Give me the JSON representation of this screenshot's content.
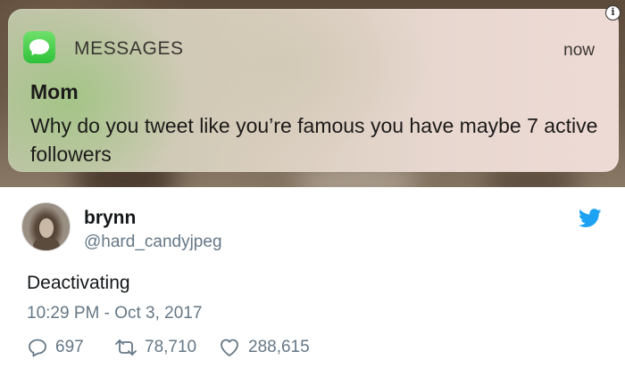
{
  "notification": {
    "app_name": "MESSAGES",
    "time": "now",
    "sender": "Mom",
    "message": "Why do you tweet like you’re famous you have maybe 7 active followers",
    "app_icon": "messages-app-icon",
    "info_icon": "i"
  },
  "tweet": {
    "display_name": "brynn",
    "handle": "@hard_candyjpeg",
    "text": "Deactivating",
    "timestamp": "10:29 PM - Oct 3, 2017",
    "brand_icon": "twitter-bird-icon",
    "brand_color": "#1da1f2",
    "actions": {
      "replies": "697",
      "retweets": "78,710",
      "likes": "288,615"
    }
  }
}
